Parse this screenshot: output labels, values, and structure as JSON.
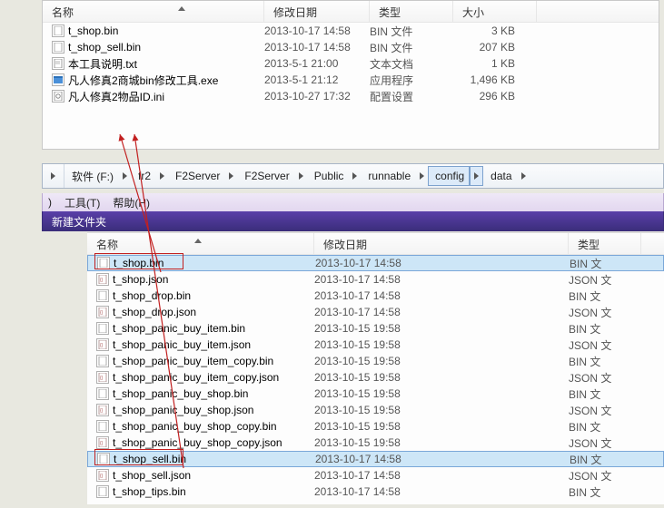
{
  "top_panel": {
    "columns": {
      "name": "名称",
      "date": "修改日期",
      "type": "类型",
      "size": "大小"
    },
    "files": [
      {
        "name": "t_shop.bin",
        "date": "2013-10-17 14:58",
        "type": "BIN 文件",
        "size": "3 KB",
        "icon": "bin"
      },
      {
        "name": "t_shop_sell.bin",
        "date": "2013-10-17 14:58",
        "type": "BIN 文件",
        "size": "207 KB",
        "icon": "bin"
      },
      {
        "name": "本工具说明.txt",
        "date": "2013-5-1 21:00",
        "type": "文本文档",
        "size": "1 KB",
        "icon": "txt"
      },
      {
        "name": "凡人修真2商城bin修改工具.exe",
        "date": "2013-5-1 21:12",
        "type": "应用程序",
        "size": "1,496 KB",
        "icon": "exe"
      },
      {
        "name": "凡人修真2物品ID.ini",
        "date": "2013-10-27 17:32",
        "type": "配置设置",
        "size": "296 KB",
        "icon": "ini"
      }
    ]
  },
  "breadcrumb": {
    "items": [
      {
        "label": "软件 (F:)",
        "hi": false
      },
      {
        "label": "fr2",
        "hi": false
      },
      {
        "label": "F2Server",
        "hi": false
      },
      {
        "label": "F2Server",
        "hi": false
      },
      {
        "label": "Public",
        "hi": false
      },
      {
        "label": "runnable",
        "hi": false
      },
      {
        "label": "config",
        "hi": true
      },
      {
        "label": "data",
        "hi": false
      }
    ]
  },
  "menubar": {
    "tools": "工具(T)",
    "help": "帮助(H)",
    "partial": ")"
  },
  "toolbar": {
    "new_folder": "新建文件夹"
  },
  "bottom_panel": {
    "columns": {
      "name": "名称",
      "date": "修改日期",
      "type": "类型"
    },
    "files": [
      {
        "name": "t_shop.bin",
        "date": "2013-10-17 14:58",
        "type": "BIN 文",
        "icon": "bin",
        "sel": true,
        "box": true
      },
      {
        "name": "t_shop.json",
        "date": "2013-10-17 14:58",
        "type": "JSON 文",
        "icon": "json"
      },
      {
        "name": "t_shop_drop.bin",
        "date": "2013-10-17 14:58",
        "type": "BIN 文",
        "icon": "bin"
      },
      {
        "name": "t_shop_drop.json",
        "date": "2013-10-17 14:58",
        "type": "JSON 文",
        "icon": "json"
      },
      {
        "name": "t_shop_panic_buy_item.bin",
        "date": "2013-10-15 19:58",
        "type": "BIN 文",
        "icon": "bin"
      },
      {
        "name": "t_shop_panic_buy_item.json",
        "date": "2013-10-15 19:58",
        "type": "JSON 文",
        "icon": "json"
      },
      {
        "name": "t_shop_panic_buy_item_copy.bin",
        "date": "2013-10-15 19:58",
        "type": "BIN 文",
        "icon": "bin"
      },
      {
        "name": "t_shop_panic_buy_item_copy.json",
        "date": "2013-10-15 19:58",
        "type": "JSON 文",
        "icon": "json"
      },
      {
        "name": "t_shop_panic_buy_shop.bin",
        "date": "2013-10-15 19:58",
        "type": "BIN 文",
        "icon": "bin"
      },
      {
        "name": "t_shop_panic_buy_shop.json",
        "date": "2013-10-15 19:58",
        "type": "JSON 文",
        "icon": "json"
      },
      {
        "name": "t_shop_panic_buy_shop_copy.bin",
        "date": "2013-10-15 19:58",
        "type": "BIN 文",
        "icon": "bin"
      },
      {
        "name": "t_shop_panic_buy_shop_copy.json",
        "date": "2013-10-15 19:58",
        "type": "JSON 文",
        "icon": "json"
      },
      {
        "name": "t_shop_sell.bin",
        "date": "2013-10-17 14:58",
        "type": "BIN 文",
        "icon": "bin",
        "sel": true,
        "box": true
      },
      {
        "name": "t_shop_sell.json",
        "date": "2013-10-17 14:58",
        "type": "JSON 文",
        "icon": "json"
      },
      {
        "name": "t_shop_tips.bin",
        "date": "2013-10-17 14:58",
        "type": "BIN 文",
        "icon": "bin"
      }
    ]
  }
}
